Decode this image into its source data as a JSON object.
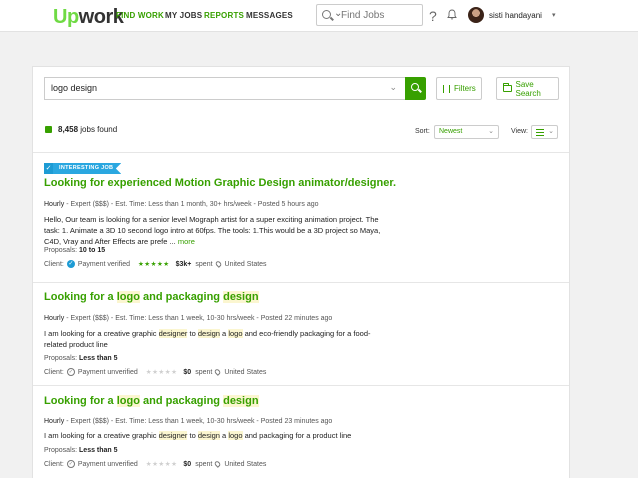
{
  "app": {
    "logo_up": "Up",
    "logo_rest": "work"
  },
  "nav": {
    "find_work": "FIND WORK",
    "my_jobs": "MY JOBS",
    "reports": "REPORTS",
    "messages": "MESSAGES"
  },
  "header_search": {
    "placeholder": "Find Jobs",
    "help_glyph": "?"
  },
  "user": {
    "name": "sisti handayani"
  },
  "search": {
    "query": "logo design",
    "filters_label": "Filters",
    "save_label": "Save Search"
  },
  "results": {
    "count": "8,458",
    "count_suffix": "jobs found",
    "sort_label": "Sort:",
    "sort_value": "Newest",
    "view_label": "View:"
  },
  "colors": {
    "brand_green": "#37a000",
    "logo_green": "#6fda44",
    "badge_blue": "#2aa7e0"
  },
  "jobs": [
    {
      "badge": "INTERESTING JOB",
      "title": "Looking for experienced Motion Graphic Design animator/designer.",
      "meta_type": "Hourly",
      "meta_rest": "- Expert ($$$) - Est. Time: Less than 1 month, 30+ hrs/week - Posted 5 hours ago",
      "description": "Hello, Our team is looking for a senior level Mograph artist for a super exciting animation project. The task: 1. Animate a 3D 10 second logo intro at 60fps. The tools: 1.This would be a 3D project so Maya, C4D, Vray and After Effects are prefe ...",
      "more": "more",
      "proposals_label": "Proposals:",
      "proposals": "10 to 15",
      "client_label": "Client:",
      "payment": "Payment verified",
      "rating": 5,
      "spent": "$3k+",
      "spent_label": "spent",
      "location": "United States"
    },
    {
      "title_parts": [
        "Looking for a ",
        "logo",
        " and packaging ",
        "design"
      ],
      "meta_type": "Hourly",
      "meta_rest": "- Expert ($$$) - Est. Time: Less than 1 week, 10-30 hrs/week - Posted 22 minutes ago",
      "desc_parts": [
        "I am looking for a creative graphic ",
        "designer",
        " to ",
        "design",
        " a ",
        "logo",
        " and eco-friendly packaging for a food-related product line"
      ],
      "proposals_label": "Proposals:",
      "proposals": "Less than 5",
      "client_label": "Client:",
      "payment": "Payment unverified",
      "rating": 0,
      "spent": "$0",
      "spent_label": "spent",
      "location": "United States"
    },
    {
      "title_parts": [
        "Looking for a ",
        "logo",
        " and packaging ",
        "design"
      ],
      "meta_type": "Hourly",
      "meta_rest": "- Expert ($$$) - Est. Time: Less than 1 week, 10-30 hrs/week - Posted 23 minutes ago",
      "desc_parts": [
        "I am looking for a creative graphic ",
        "designer",
        " to ",
        "design",
        " a ",
        "logo",
        " and packaging for a product line"
      ],
      "proposals_label": "Proposals:",
      "proposals": "Less than 5",
      "client_label": "Client:",
      "payment": "Payment unverified",
      "rating": 0,
      "spent": "$0",
      "spent_label": "spent",
      "location": "United States"
    }
  ]
}
